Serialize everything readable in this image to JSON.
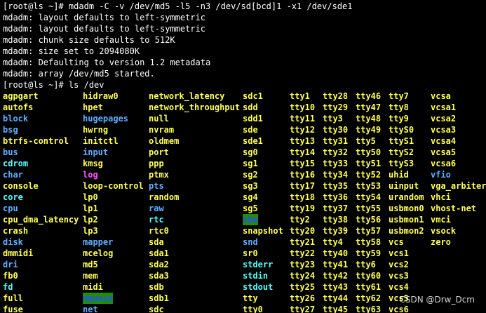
{
  "terminal": {
    "output_lines": [
      "[root@ls ~]# mdadm -C -v /dev/md5 -l5 -n3 /dev/sd[bcd]1 -x1 /dev/sde1",
      "mdadm: layout defaults to left-symmetric",
      "mdadm: layout defaults to left-symmetric",
      "mdadm: chunk size defaults to 512K",
      "mdadm: size set to 2094080K",
      "mdadm: Defaulting to version 1.2 metadata",
      "mdadm: array /dev/md5 started.",
      "[root@ls ~]# ls /dev"
    ],
    "listing_columns": [
      {
        "col": 0,
        "entries": [
          {
            "t": "agpgart",
            "c": "yellow"
          },
          {
            "t": "autofs",
            "c": "yellow"
          },
          {
            "t": "block",
            "c": "blue"
          },
          {
            "t": "bsg",
            "c": "blue"
          },
          {
            "t": "btrfs-control",
            "c": "yellow"
          },
          {
            "t": "bus",
            "c": "blue"
          },
          {
            "t": "cdrom",
            "c": "cyan"
          },
          {
            "t": "char",
            "c": "blue"
          },
          {
            "t": "console",
            "c": "yellow"
          },
          {
            "t": "core",
            "c": "cyan"
          },
          {
            "t": "cpu",
            "c": "blue"
          },
          {
            "t": "cpu_dma_latency",
            "c": "yellow"
          },
          {
            "t": "crash",
            "c": "yellow"
          },
          {
            "t": "disk",
            "c": "blue"
          },
          {
            "t": "dmmidi",
            "c": "yellow"
          },
          {
            "t": "dri",
            "c": "blue"
          },
          {
            "t": "fb0",
            "c": "yellow"
          },
          {
            "t": "fd",
            "c": "cyan"
          },
          {
            "t": "full",
            "c": "yellow"
          },
          {
            "t": "fuse",
            "c": "yellow"
          }
        ]
      },
      {
        "col": 1,
        "entries": [
          {
            "t": "hidraw0",
            "c": "yellow"
          },
          {
            "t": "hpet",
            "c": "yellow"
          },
          {
            "t": "hugepages",
            "c": "blue"
          },
          {
            "t": "hwrng",
            "c": "yellow"
          },
          {
            "t": "initctl",
            "c": "yellow"
          },
          {
            "t": "input",
            "c": "blue"
          },
          {
            "t": "kmsg",
            "c": "yellow"
          },
          {
            "t": "log",
            "c": "magenta"
          },
          {
            "t": "loop-control",
            "c": "yellow"
          },
          {
            "t": "lp0",
            "c": "yellow"
          },
          {
            "t": "lp1",
            "c": "yellow"
          },
          {
            "t": "lp2",
            "c": "yellow"
          },
          {
            "t": "lp3",
            "c": "yellow"
          },
          {
            "t": "mapper",
            "c": "blue"
          },
          {
            "t": "mcelog",
            "c": "yellow"
          },
          {
            "t": "md5",
            "c": "yellow"
          },
          {
            "t": "mem",
            "c": "yellow"
          },
          {
            "t": "midi",
            "c": "yellow"
          },
          {
            "t": "mqueue",
            "c": "hl-green"
          },
          {
            "t": "net",
            "c": "blue"
          }
        ]
      },
      {
        "col": 2,
        "entries": [
          {
            "t": "network_latency",
            "c": "yellow"
          },
          {
            "t": "network_throughput",
            "c": "yellow"
          },
          {
            "t": "null",
            "c": "yellow"
          },
          {
            "t": "nvram",
            "c": "yellow"
          },
          {
            "t": "oldmem",
            "c": "yellow"
          },
          {
            "t": "port",
            "c": "yellow"
          },
          {
            "t": "ppp",
            "c": "yellow"
          },
          {
            "t": "ptmx",
            "c": "yellow"
          },
          {
            "t": "pts",
            "c": "blue"
          },
          {
            "t": "random",
            "c": "yellow"
          },
          {
            "t": "raw",
            "c": "blue"
          },
          {
            "t": "rtc",
            "c": "cyan"
          },
          {
            "t": "rtc0",
            "c": "yellow"
          },
          {
            "t": "sda",
            "c": "yellow"
          },
          {
            "t": "sda1",
            "c": "yellow"
          },
          {
            "t": "sda2",
            "c": "yellow"
          },
          {
            "t": "sda3",
            "c": "yellow"
          },
          {
            "t": "sdb",
            "c": "yellow"
          },
          {
            "t": "sdb1",
            "c": "yellow"
          },
          {
            "t": "sdc",
            "c": "yellow"
          }
        ]
      },
      {
        "col": 3,
        "entries": [
          {
            "t": "sdc1",
            "c": "yellow"
          },
          {
            "t": "sdd",
            "c": "yellow"
          },
          {
            "t": "sdd1",
            "c": "yellow"
          },
          {
            "t": "sde",
            "c": "yellow"
          },
          {
            "t": "sde1",
            "c": "yellow"
          },
          {
            "t": "sg0",
            "c": "yellow"
          },
          {
            "t": "sg1",
            "c": "yellow"
          },
          {
            "t": "sg2",
            "c": "yellow"
          },
          {
            "t": "sg3",
            "c": "yellow"
          },
          {
            "t": "sg4",
            "c": "yellow"
          },
          {
            "t": "sg5",
            "c": "yellow"
          },
          {
            "t": "shm",
            "c": "hl-green"
          },
          {
            "t": "snapshot",
            "c": "yellow"
          },
          {
            "t": "snd",
            "c": "blue"
          },
          {
            "t": "sr0",
            "c": "yellow"
          },
          {
            "t": "stderr",
            "c": "cyan"
          },
          {
            "t": "stdin",
            "c": "cyan"
          },
          {
            "t": "stdout",
            "c": "cyan"
          },
          {
            "t": "tty",
            "c": "yellow"
          },
          {
            "t": "tty0",
            "c": "yellow"
          }
        ]
      },
      {
        "col": 4,
        "entries": [
          {
            "t": "tty1",
            "c": "yellow"
          },
          {
            "t": "tty10",
            "c": "yellow"
          },
          {
            "t": "tty11",
            "c": "yellow"
          },
          {
            "t": "tty12",
            "c": "yellow"
          },
          {
            "t": "tty13",
            "c": "yellow"
          },
          {
            "t": "tty14",
            "c": "yellow"
          },
          {
            "t": "tty15",
            "c": "yellow"
          },
          {
            "t": "tty16",
            "c": "yellow"
          },
          {
            "t": "tty17",
            "c": "yellow"
          },
          {
            "t": "tty18",
            "c": "yellow"
          },
          {
            "t": "tty19",
            "c": "yellow"
          },
          {
            "t": "tty2",
            "c": "yellow"
          },
          {
            "t": "tty20",
            "c": "yellow"
          },
          {
            "t": "tty21",
            "c": "yellow"
          },
          {
            "t": "tty22",
            "c": "yellow"
          },
          {
            "t": "tty23",
            "c": "yellow"
          },
          {
            "t": "tty24",
            "c": "yellow"
          },
          {
            "t": "tty25",
            "c": "yellow"
          },
          {
            "t": "tty26",
            "c": "yellow"
          },
          {
            "t": "tty27",
            "c": "yellow"
          }
        ]
      },
      {
        "col": 5,
        "entries": [
          {
            "t": "tty28",
            "c": "yellow"
          },
          {
            "t": "tty29",
            "c": "yellow"
          },
          {
            "t": "tty3",
            "c": "yellow"
          },
          {
            "t": "tty30",
            "c": "yellow"
          },
          {
            "t": "tty31",
            "c": "yellow"
          },
          {
            "t": "tty32",
            "c": "yellow"
          },
          {
            "t": "tty33",
            "c": "yellow"
          },
          {
            "t": "tty34",
            "c": "yellow"
          },
          {
            "t": "tty35",
            "c": "yellow"
          },
          {
            "t": "tty36",
            "c": "yellow"
          },
          {
            "t": "tty37",
            "c": "yellow"
          },
          {
            "t": "tty38",
            "c": "yellow"
          },
          {
            "t": "tty39",
            "c": "yellow"
          },
          {
            "t": "tty4",
            "c": "yellow"
          },
          {
            "t": "tty40",
            "c": "yellow"
          },
          {
            "t": "tty41",
            "c": "yellow"
          },
          {
            "t": "tty42",
            "c": "yellow"
          },
          {
            "t": "tty43",
            "c": "yellow"
          },
          {
            "t": "tty44",
            "c": "yellow"
          },
          {
            "t": "tty45",
            "c": "yellow"
          }
        ]
      },
      {
        "col": 6,
        "entries": [
          {
            "t": "tty46",
            "c": "yellow"
          },
          {
            "t": "tty47",
            "c": "yellow"
          },
          {
            "t": "tty48",
            "c": "yellow"
          },
          {
            "t": "tty49",
            "c": "yellow"
          },
          {
            "t": "tty5",
            "c": "yellow"
          },
          {
            "t": "tty50",
            "c": "yellow"
          },
          {
            "t": "tty51",
            "c": "yellow"
          },
          {
            "t": "tty52",
            "c": "yellow"
          },
          {
            "t": "tty53",
            "c": "yellow"
          },
          {
            "t": "tty54",
            "c": "yellow"
          },
          {
            "t": "tty55",
            "c": "yellow"
          },
          {
            "t": "tty56",
            "c": "yellow"
          },
          {
            "t": "tty57",
            "c": "yellow"
          },
          {
            "t": "tty58",
            "c": "yellow"
          },
          {
            "t": "tty59",
            "c": "yellow"
          },
          {
            "t": "tty6",
            "c": "yellow"
          },
          {
            "t": "tty60",
            "c": "yellow"
          },
          {
            "t": "tty61",
            "c": "yellow"
          },
          {
            "t": "tty62",
            "c": "yellow"
          },
          {
            "t": "tty63",
            "c": "yellow"
          }
        ]
      },
      {
        "col": 7,
        "entries": [
          {
            "t": "tty7",
            "c": "yellow"
          },
          {
            "t": "tty8",
            "c": "yellow"
          },
          {
            "t": "tty9",
            "c": "yellow"
          },
          {
            "t": "ttyS0",
            "c": "yellow"
          },
          {
            "t": "ttyS1",
            "c": "yellow"
          },
          {
            "t": "ttyS2",
            "c": "yellow"
          },
          {
            "t": "ttyS3",
            "c": "yellow"
          },
          {
            "t": "uhid",
            "c": "yellow"
          },
          {
            "t": "uinput",
            "c": "yellow"
          },
          {
            "t": "urandom",
            "c": "yellow"
          },
          {
            "t": "usbmon0",
            "c": "yellow"
          },
          {
            "t": "usbmon1",
            "c": "yellow"
          },
          {
            "t": "usbmon2",
            "c": "yellow"
          },
          {
            "t": "vcs",
            "c": "yellow"
          },
          {
            "t": "vcs1",
            "c": "yellow"
          },
          {
            "t": "vcs2",
            "c": "yellow"
          },
          {
            "t": "vcs3",
            "c": "yellow"
          },
          {
            "t": "vcs4",
            "c": "yellow"
          },
          {
            "t": "vcs5",
            "c": "yellow"
          },
          {
            "t": "vcs6",
            "c": "yellow"
          }
        ]
      },
      {
        "col": 8,
        "entries": [
          {
            "t": "vcsa",
            "c": "yellow"
          },
          {
            "t": "vcsa1",
            "c": "yellow"
          },
          {
            "t": "vcsa2",
            "c": "yellow"
          },
          {
            "t": "vcsa3",
            "c": "yellow"
          },
          {
            "t": "vcsa4",
            "c": "yellow"
          },
          {
            "t": "vcsa5",
            "c": "yellow"
          },
          {
            "t": "vcsa6",
            "c": "yellow"
          },
          {
            "t": "vfio",
            "c": "blue"
          },
          {
            "t": "vga_arbiter",
            "c": "yellow"
          },
          {
            "t": "vhci",
            "c": "yellow"
          },
          {
            "t": "vhost-net",
            "c": "yellow"
          },
          {
            "t": "vmci",
            "c": "yellow"
          },
          {
            "t": "vsock",
            "c": "yellow"
          },
          {
            "t": "zero",
            "c": "yellow"
          },
          {
            "t": "",
            "c": "yellow"
          },
          {
            "t": "",
            "c": "yellow"
          },
          {
            "t": "",
            "c": "yellow"
          },
          {
            "t": "",
            "c": "yellow"
          },
          {
            "t": "",
            "c": "yellow"
          },
          {
            "t": "",
            "c": "yellow"
          }
        ]
      }
    ]
  },
  "colors": {
    "background": "#000000",
    "text": "#ffffff",
    "file": "#ffff55",
    "directory": "#5fafff",
    "symlink": "#55ffff",
    "socket": "#ff55ff",
    "highlight_bg": "#1f8f00"
  },
  "watermark": {
    "text": "CSDN @Drw_Dcm"
  }
}
